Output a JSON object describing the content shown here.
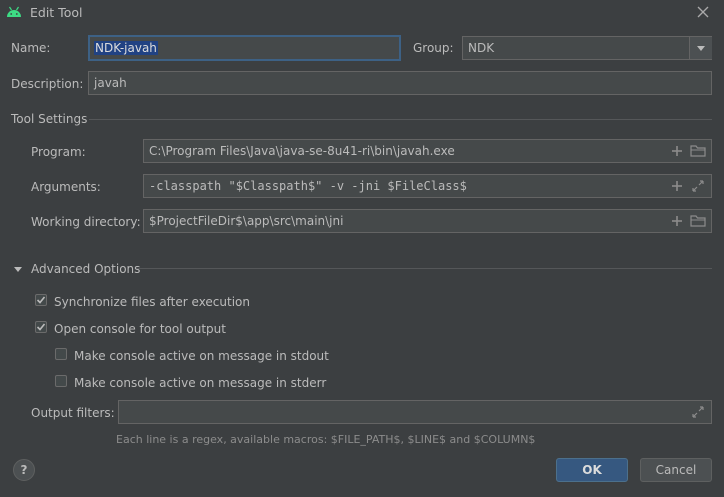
{
  "window": {
    "title": "Edit Tool"
  },
  "name": {
    "label": "Name:",
    "value": "NDK-javah"
  },
  "group": {
    "label": "Group:",
    "value": "NDK"
  },
  "description": {
    "label": "Description:",
    "value": "javah"
  },
  "tool_settings": {
    "header": "Tool Settings",
    "program": {
      "label": "Program:",
      "value": "C:\\Program Files\\Java\\java-se-8u41-ri\\bin\\javah.exe"
    },
    "arguments": {
      "label": "Arguments:",
      "value": "-classpath \"$Classpath$\" -v -jni $FileClass$"
    },
    "working_directory": {
      "label": "Working directory:",
      "value": "$ProjectFileDir$\\app\\src\\main\\jni"
    }
  },
  "advanced": {
    "header": "Advanced Options",
    "sync_files": {
      "label": "Synchronize files after execution",
      "checked": true
    },
    "open_console": {
      "label": "Open console for tool output",
      "checked": true
    },
    "active_stdout": {
      "label": "Make console active on message in stdout",
      "checked": false
    },
    "active_stderr": {
      "label": "Make console active on message in stderr",
      "checked": false
    },
    "output_filters": {
      "label": "Output filters:",
      "value": ""
    },
    "hint": "Each line is a regex, available macros: $FILE_PATH$, $LINE$ and $COLUMN$"
  },
  "buttons": {
    "help": "?",
    "ok": "OK",
    "cancel": "Cancel"
  },
  "colors": {
    "accent": "#365880",
    "focus": "#3d6185",
    "selection": "#214283",
    "android": "#3ddc84",
    "background": "#3c3f41"
  }
}
